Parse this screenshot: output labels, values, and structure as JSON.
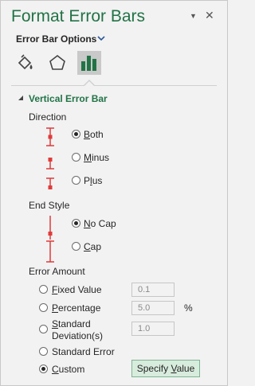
{
  "header": {
    "title": "Format Error Bars",
    "close": "✕",
    "menu_arrow": "▼"
  },
  "options": {
    "label": "Error Bar Options",
    "chevron": "⌄"
  },
  "tabs": [
    {
      "name": "fill-line-icon",
      "selected": false
    },
    {
      "name": "effects-icon",
      "selected": false
    },
    {
      "name": "error-bar-options-icon",
      "selected": true
    }
  ],
  "section": {
    "title": "Vertical Error Bar"
  },
  "direction": {
    "label": "Direction",
    "options": [
      {
        "pre": "",
        "u": "B",
        "post": "oth",
        "checked": true
      },
      {
        "pre": "",
        "u": "M",
        "post": "inus",
        "checked": false
      },
      {
        "pre": "P",
        "u": "l",
        "post": "us",
        "checked": false
      }
    ]
  },
  "end_style": {
    "label": "End Style",
    "options": [
      {
        "pre": "",
        "u": "N",
        "post": "o Cap",
        "checked": true
      },
      {
        "pre": "",
        "u": "C",
        "post": "ap",
        "checked": false
      }
    ]
  },
  "error_amount": {
    "label": "Error Amount",
    "fixed": {
      "pre": "",
      "u": "F",
      "post": "ixed Value",
      "value": "0.1"
    },
    "percentage": {
      "pre": "",
      "u": "P",
      "post": "ercentage",
      "value": "5.0",
      "unit": "%"
    },
    "stddev": {
      "line1_pre": "",
      "line1_u": "S",
      "line1_post": "tandard",
      "line2": "Deviation(s)",
      "value": "1.0"
    },
    "stderr": {
      "label": "Standard Error"
    },
    "custom": {
      "pre": "",
      "u": "C",
      "post": "ustom",
      "checked": true
    },
    "specify": {
      "pre": "Specify ",
      "u": "V",
      "post": "alue"
    }
  },
  "colors": {
    "accent": "#217346",
    "marker": "#e03b3b"
  }
}
